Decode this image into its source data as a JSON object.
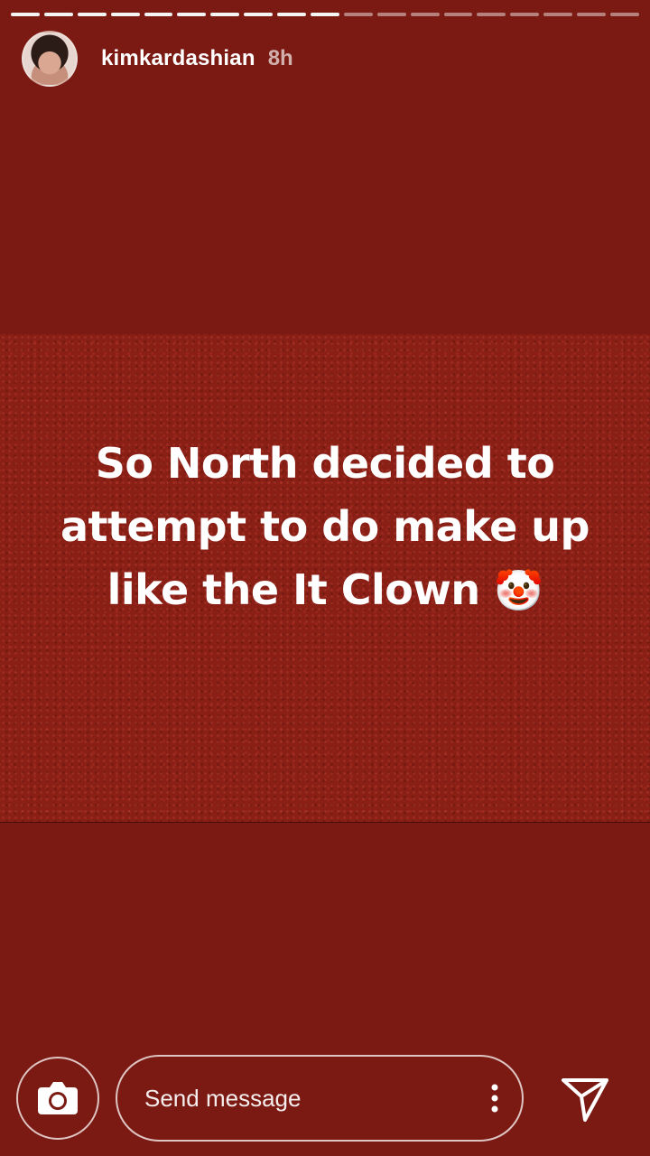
{
  "story": {
    "progress_total": 19,
    "progress_current_index": 10,
    "username": "kimkardashian",
    "time_ago": "8h",
    "caption": "So North decided to attempt to do make up like the It Clown",
    "caption_emoji": "🤡"
  },
  "footer": {
    "message_placeholder": "Send message"
  },
  "icons": {
    "camera": "camera-icon",
    "more": "more-vertical-icon",
    "send": "send-paper-plane-icon"
  },
  "colors": {
    "background": "#7b1a13",
    "story_texture": "#8a1f16",
    "text": "#ffffff"
  }
}
